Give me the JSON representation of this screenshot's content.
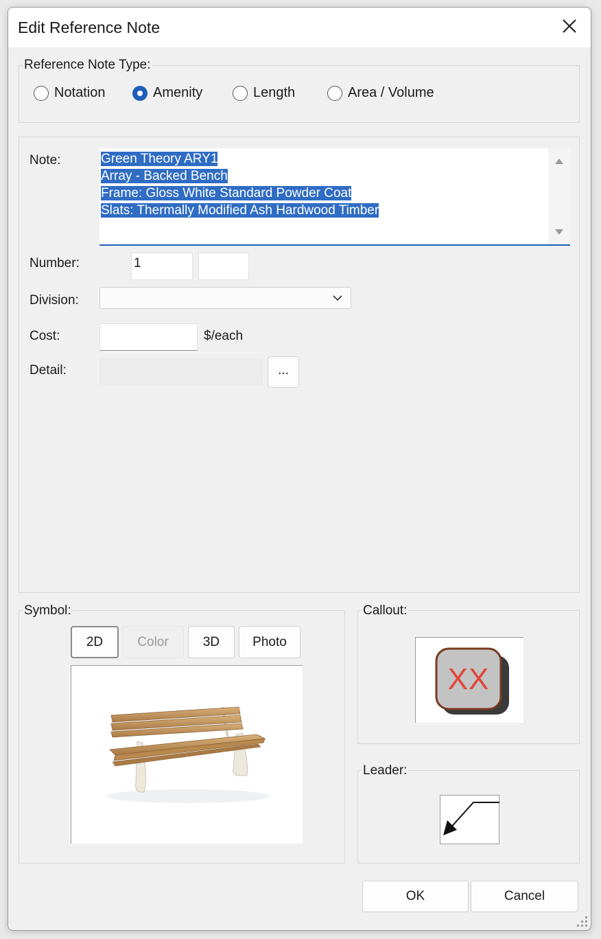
{
  "window": {
    "title": "Edit Reference Note"
  },
  "ref_type": {
    "label": "Reference Note Type:",
    "options": [
      {
        "label": "Notation",
        "checked": false
      },
      {
        "label": "Amenity",
        "checked": true
      },
      {
        "label": "Length",
        "checked": false
      },
      {
        "label": "Area / Volume",
        "checked": false
      }
    ]
  },
  "form": {
    "note_label": "Note:",
    "note_lines": [
      "Green Theory ARY1",
      "Array - Backed Bench",
      "Frame: Gloss White Standard Powder Coat",
      "Slats: Thermally Modified Ash Hardwood Timber"
    ],
    "number_label": "Number:",
    "number_value": "1",
    "number_value2": "",
    "division_label": "Division:",
    "division_value": "",
    "cost_label": "Cost:",
    "cost_value": "",
    "cost_unit": "$/each",
    "detail_label": "Detail:",
    "detail_value": "",
    "browse_label": "..."
  },
  "symbol": {
    "label": "Symbol:",
    "tabs": [
      "2D",
      "Color",
      "3D",
      "Photo"
    ],
    "selected_tab": "2D",
    "disabled_tab": "Color"
  },
  "callout": {
    "label": "Callout:",
    "text": "XX",
    "text_color": "#e0463a"
  },
  "leader": {
    "label": "Leader:"
  },
  "buttons": {
    "ok": "OK",
    "cancel": "Cancel"
  },
  "colors": {
    "accent": "#1f5fb8",
    "selection": "#2f6cc4"
  },
  "icons": [
    "close-icon",
    "scroll-up-icon",
    "scroll-down-icon",
    "chevron-down-icon",
    "bench-image",
    "callout-symbol-icon",
    "leader-arrow-icon",
    "resize-grip-icon"
  ]
}
